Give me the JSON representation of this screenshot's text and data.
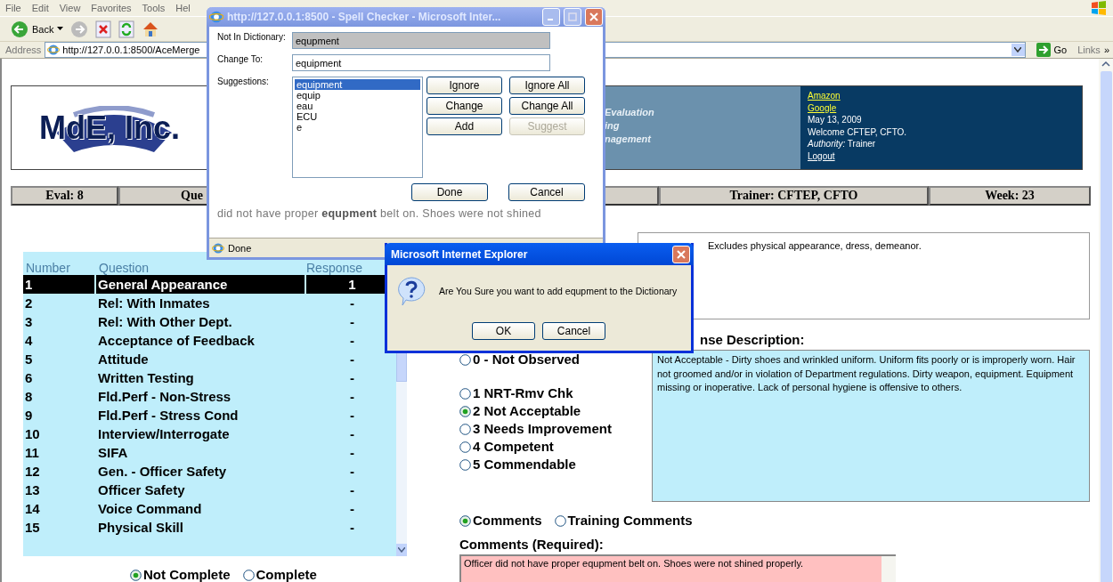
{
  "browser": {
    "menu": [
      "File",
      "Edit",
      "View",
      "Favorites",
      "Tools",
      "Hel"
    ],
    "back_label": "Back",
    "address": {
      "label": "Address",
      "url": "http://127.0.0.1:8500/AceMerge",
      "go": "Go",
      "links": "Links",
      "more": "»"
    }
  },
  "page": {
    "logo": "MdE, Inc.",
    "banner_lines": [
      "Evaluation",
      "ing",
      "nagement"
    ],
    "user_panel": {
      "links": [
        "Amazon",
        "Google"
      ],
      "date": "May 13, 2009",
      "welcome": "Welcome CFTEP, CFTO.",
      "authority_label": "Authority:",
      "authority": "Trainer",
      "logout": "Logout"
    },
    "info_bar": [
      "Eval: 8",
      "Que",
      "Trainer: CFTEP, CFTO",
      "Week: 23"
    ],
    "questions": {
      "columns": [
        "Number",
        "Question",
        "Response"
      ],
      "rows": [
        {
          "number": "1",
          "question": "General Appearance",
          "response": "1",
          "selected": true
        },
        {
          "number": "2",
          "question": "Rel: With Inmates",
          "response": "-",
          "selected": false
        },
        {
          "number": "3",
          "question": "Rel: With Other Dept.",
          "response": "-",
          "selected": false
        },
        {
          "number": "4",
          "question": "Acceptance of Feedback",
          "response": "-",
          "selected": false
        },
        {
          "number": "5",
          "question": "Attitude",
          "response": "-",
          "selected": false
        },
        {
          "number": "6",
          "question": "Written Testing",
          "response": "-",
          "selected": false
        },
        {
          "number": "8",
          "question": "Fld.Perf - Non-Stress",
          "response": "-",
          "selected": false
        },
        {
          "number": "9",
          "question": "Fld.Perf - Stress Cond",
          "response": "-",
          "selected": false
        },
        {
          "number": "10",
          "question": "Interview/Interrogate",
          "response": "-",
          "selected": false
        },
        {
          "number": "11",
          "question": "SIFA",
          "response": "-",
          "selected": false
        },
        {
          "number": "12",
          "question": "Gen. - Officer Safety",
          "response": "-",
          "selected": false
        },
        {
          "number": "13",
          "question": "Officer Safety",
          "response": "-",
          "selected": false
        },
        {
          "number": "14",
          "question": "Voice Command",
          "response": "-",
          "selected": false
        },
        {
          "number": "15",
          "question": "Physical Skill",
          "response": "-",
          "selected": false
        }
      ]
    },
    "completion": [
      {
        "label": "Not Complete",
        "selected": true
      },
      {
        "label": "Complete",
        "selected": false
      }
    ],
    "question_description": "Excludes physical appearance, dress, demeanor.",
    "response_description_label": "nse Description:",
    "ratings": [
      {
        "label": "0 - Not Observed",
        "selected": false
      },
      {
        "label": "1 NRT-Rmv Chk",
        "selected": false
      },
      {
        "label": "2 Not Acceptable",
        "selected": true
      },
      {
        "label": "3 Needs Improvement",
        "selected": false
      },
      {
        "label": "4 Competent",
        "selected": false
      },
      {
        "label": "5 Commendable",
        "selected": false
      }
    ],
    "response_description": "Not Acceptable - Dirty shoes and wrinkled uniform. Uniform fits poorly or is improperly worn. Hair not groomed and/or in violation of Department regulations. Dirty weapon, equipment. Equipment missing or inoperative. Lack of personal hygiene is offensive to others.",
    "comment_tabs": [
      {
        "label": "Comments",
        "selected": true
      },
      {
        "label": "Training Comments",
        "selected": false
      }
    ],
    "comments_label": "Comments (Required):",
    "comments_value": "Officer did not have proper equpment belt on.  Shoes were not shined properly."
  },
  "spell_checker": {
    "title": "http://127.0.0.1:8500 - Spell Checker - Microsoft Inter...",
    "not_in_dictionary_label": "Not In Dictionary:",
    "not_in_dictionary": "equpment",
    "change_to_label": "Change To:",
    "change_to": "equipment",
    "suggestions_label": "Suggestions:",
    "suggestions": [
      {
        "text": "equipment",
        "selected": true
      },
      {
        "text": "equip",
        "selected": false
      },
      {
        "text": "eau",
        "selected": false
      },
      {
        "text": "ECU",
        "selected": false
      },
      {
        "text": "e",
        "selected": false
      }
    ],
    "buttons": [
      {
        "label": "Ignore",
        "disabled": false
      },
      {
        "label": "Ignore All",
        "disabled": false
      },
      {
        "label": "Change",
        "disabled": false
      },
      {
        "label": "Change All",
        "disabled": false
      },
      {
        "label": "Add",
        "disabled": false
      },
      {
        "label": "Suggest",
        "disabled": true
      }
    ],
    "footer_buttons": [
      "Done",
      "Cancel"
    ],
    "context": "did not have proper **equpment** belt on. Shoes were not shined",
    "status": "Done"
  },
  "alert": {
    "title": "Microsoft Internet Explorer",
    "message": "Are You Sure you want to add equpment to the Dictionary",
    "buttons": [
      "OK",
      "Cancel"
    ]
  }
}
